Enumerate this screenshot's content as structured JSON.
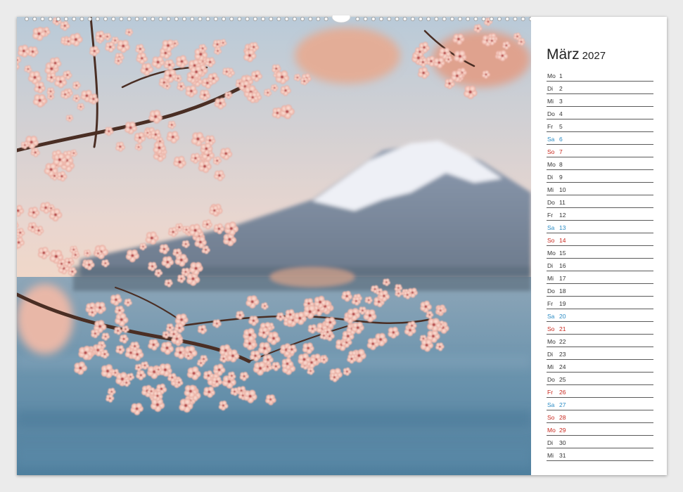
{
  "calendar": {
    "month": "März",
    "year": "2027",
    "days": [
      {
        "wd": "Mo",
        "d": "1",
        "type": "weekday"
      },
      {
        "wd": "Di",
        "d": "2",
        "type": "weekday"
      },
      {
        "wd": "Mi",
        "d": "3",
        "type": "weekday"
      },
      {
        "wd": "Do",
        "d": "4",
        "type": "weekday"
      },
      {
        "wd": "Fr",
        "d": "5",
        "type": "weekday"
      },
      {
        "wd": "Sa",
        "d": "6",
        "type": "saturday"
      },
      {
        "wd": "So",
        "d": "7",
        "type": "sunday"
      },
      {
        "wd": "Mo",
        "d": "8",
        "type": "weekday"
      },
      {
        "wd": "Di",
        "d": "9",
        "type": "weekday"
      },
      {
        "wd": "Mi",
        "d": "10",
        "type": "weekday"
      },
      {
        "wd": "Do",
        "d": "11",
        "type": "weekday"
      },
      {
        "wd": "Fr",
        "d": "12",
        "type": "weekday"
      },
      {
        "wd": "Sa",
        "d": "13",
        "type": "saturday"
      },
      {
        "wd": "So",
        "d": "14",
        "type": "sunday"
      },
      {
        "wd": "Mo",
        "d": "15",
        "type": "weekday"
      },
      {
        "wd": "Di",
        "d": "16",
        "type": "weekday"
      },
      {
        "wd": "Mi",
        "d": "17",
        "type": "weekday"
      },
      {
        "wd": "Do",
        "d": "18",
        "type": "weekday"
      },
      {
        "wd": "Fr",
        "d": "19",
        "type": "weekday"
      },
      {
        "wd": "Sa",
        "d": "20",
        "type": "saturday"
      },
      {
        "wd": "So",
        "d": "21",
        "type": "sunday"
      },
      {
        "wd": "Mo",
        "d": "22",
        "type": "weekday"
      },
      {
        "wd": "Di",
        "d": "23",
        "type": "weekday"
      },
      {
        "wd": "Mi",
        "d": "24",
        "type": "weekday"
      },
      {
        "wd": "Do",
        "d": "25",
        "type": "weekday"
      },
      {
        "wd": "Fr",
        "d": "26",
        "type": "holiday"
      },
      {
        "wd": "Sa",
        "d": "27",
        "type": "saturday"
      },
      {
        "wd": "So",
        "d": "28",
        "type": "sunday"
      },
      {
        "wd": "Mo",
        "d": "29",
        "type": "holiday"
      },
      {
        "wd": "Di",
        "d": "30",
        "type": "weekday"
      },
      {
        "wd": "Mi",
        "d": "31",
        "type": "weekday"
      }
    ]
  },
  "photo": {
    "subject": "cherry-blossom-branches-mount-fuji-lake",
    "colors": {
      "sky_top": "#b8c9d6",
      "sky_bottom": "#f1d9cc",
      "mountain": "#7b8a9c",
      "snow": "#f3f4f8",
      "water": "#5f8aa6",
      "blossom": "#f6c9bd",
      "blossom_dark": "#d98e84",
      "branch": "#4a2e24"
    }
  },
  "colors": {
    "saturday": "#2a8bc4",
    "sunday": "#c8281e",
    "rule": "#5a5a5a",
    "paper": "#ffffff",
    "background": "#ebebeb"
  }
}
